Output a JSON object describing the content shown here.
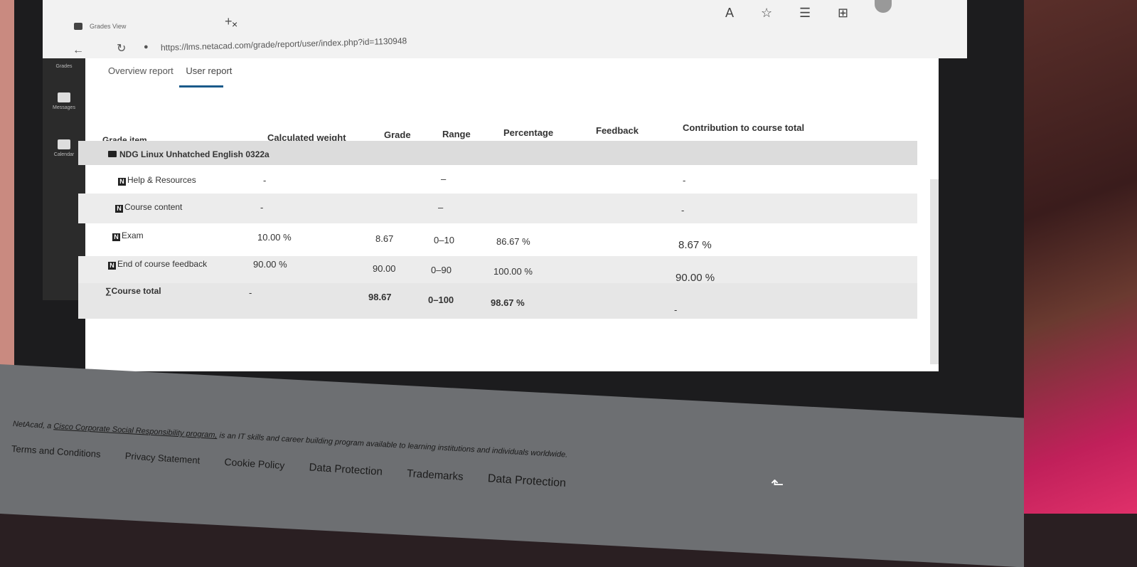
{
  "browser": {
    "tab_title": "Grades View",
    "tab_close": "×",
    "new_tab": "+",
    "url": "https://lms.netacad.com/grade/report/user/index.php?id=1130948",
    "back": "←",
    "reload": "↻",
    "lock": "🔒"
  },
  "rail": {
    "items": [
      {
        "label": "Grades"
      },
      {
        "label": "Messages"
      },
      {
        "label": "Calendar"
      }
    ]
  },
  "report_tabs": {
    "overview": "Overview report",
    "user": "User report"
  },
  "table": {
    "headers": {
      "grade_item": "Grade item",
      "calculated_weight": "Calculated weight",
      "grade": "Grade",
      "range": "Range",
      "percentage": "Percentage",
      "feedback": "Feedback",
      "contribution": "Contribution to course total"
    },
    "category": "NDG Linux Unhatched English 0322a",
    "rows": [
      {
        "item": "Help & Resources",
        "weight": "-",
        "grade": "",
        "range": "–",
        "percentage": "",
        "feedback": "",
        "contribution": "-"
      },
      {
        "item": "Course content",
        "weight": "-",
        "grade": "",
        "range": "–",
        "percentage": "",
        "feedback": "",
        "contribution": "-"
      },
      {
        "item": "Exam",
        "weight": "10.00 %",
        "grade": "8.67",
        "range": "0–10",
        "percentage": "86.67 %",
        "feedback": "",
        "contribution": "8.67 %"
      },
      {
        "item": "End of course feedback",
        "weight": "90.00 %",
        "grade": "90.00",
        "range": "0–90",
        "percentage": "100.00 %",
        "feedback": "",
        "contribution": "90.00 %"
      }
    ],
    "total": {
      "item": "Course total",
      "weight": "-",
      "grade": "98.67",
      "range": "0–100",
      "percentage": "98.67 %",
      "contribution": "-"
    }
  },
  "footer": {
    "text_prefix": "NetAcad, a ",
    "text_link": "Cisco Corporate Social Responsibility program,",
    "text_suffix": " is an IT skills and career building program available to learning institutions and individuals worldwide.",
    "links": [
      "Terms and Conditions",
      "Privacy Statement",
      "Cookie Policy",
      "Data Protection",
      "Trademarks",
      "Data Protection"
    ]
  },
  "icons": {
    "sum": "∑",
    "n": "N"
  }
}
